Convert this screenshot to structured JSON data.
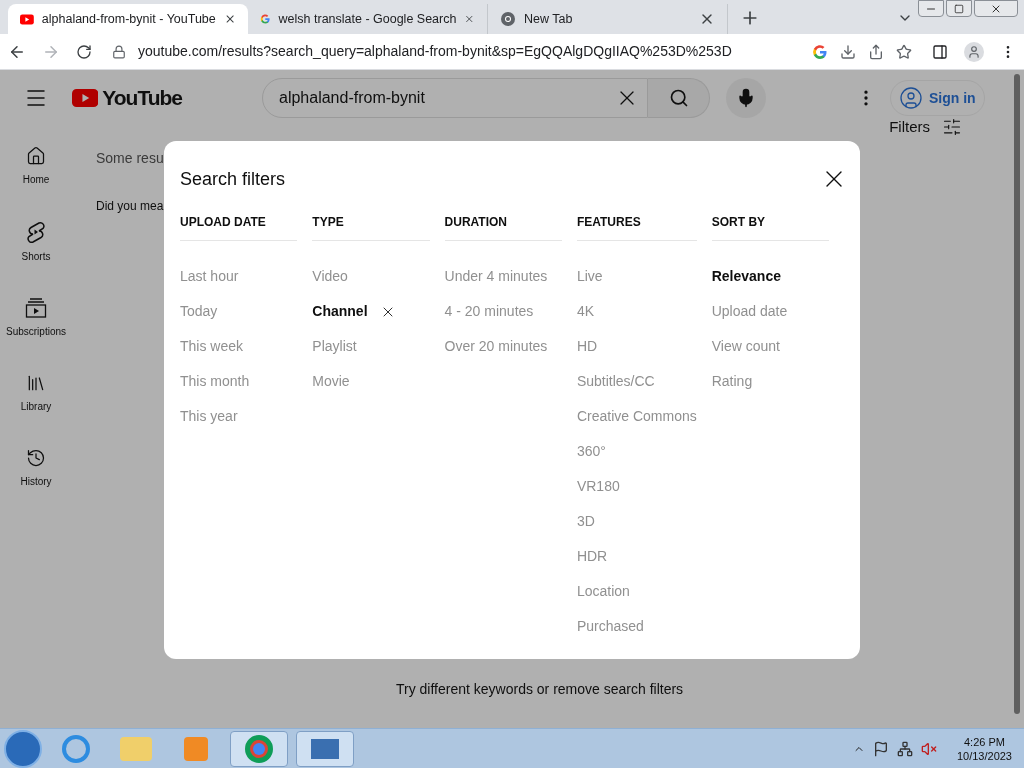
{
  "browser": {
    "tabs": [
      {
        "title": "alphaland-from-bynit - YouTube",
        "selected": true
      },
      {
        "title": "welsh translate - Google Search",
        "selected": false
      },
      {
        "title": "New Tab",
        "selected": false
      }
    ],
    "url": "youtube.com/results?search_query=alphaland-from-bynit&sp=EgQQAlgDQgIIAQ%253D%253D"
  },
  "header": {
    "logo": "YouTube",
    "search_value": "alphaland-from-bynit",
    "sign_in": "Sign in",
    "filters": "Filters"
  },
  "sidebar": {
    "items": [
      {
        "label": "Home"
      },
      {
        "label": "Shorts"
      },
      {
        "label": "Subscriptions"
      },
      {
        "label": "Library"
      },
      {
        "label": "History"
      }
    ]
  },
  "results": {
    "notice": "Some resu",
    "did_you_mean": "Did you mea",
    "empty_message": "Try different keywords or remove search filters"
  },
  "dialog": {
    "title": "Search filters",
    "columns": [
      {
        "heading": "UPLOAD DATE",
        "kind": "filter",
        "options": [
          {
            "label": "Last hour",
            "selected": false
          },
          {
            "label": "Today",
            "selected": false
          },
          {
            "label": "This week",
            "selected": false
          },
          {
            "label": "This month",
            "selected": false
          },
          {
            "label": "This year",
            "selected": false
          }
        ]
      },
      {
        "heading": "TYPE",
        "kind": "filter",
        "options": [
          {
            "label": "Video",
            "selected": false
          },
          {
            "label": "Channel",
            "selected": true
          },
          {
            "label": "Playlist",
            "selected": false
          },
          {
            "label": "Movie",
            "selected": false
          }
        ]
      },
      {
        "heading": "DURATION",
        "kind": "filter",
        "options": [
          {
            "label": "Under 4 minutes",
            "selected": false
          },
          {
            "label": "4 - 20 minutes",
            "selected": false
          },
          {
            "label": "Over 20 minutes",
            "selected": false
          }
        ]
      },
      {
        "heading": "FEATURES",
        "kind": "filter",
        "options": [
          {
            "label": "Live",
            "selected": false
          },
          {
            "label": "4K",
            "selected": false
          },
          {
            "label": "HD",
            "selected": false
          },
          {
            "label": "Subtitles/CC",
            "selected": false
          },
          {
            "label": "Creative Commons",
            "selected": false
          },
          {
            "label": "360°",
            "selected": false
          },
          {
            "label": "VR180",
            "selected": false
          },
          {
            "label": "3D",
            "selected": false
          },
          {
            "label": "HDR",
            "selected": false
          },
          {
            "label": "Location",
            "selected": false
          },
          {
            "label": "Purchased",
            "selected": false
          }
        ]
      },
      {
        "heading": "SORT BY",
        "kind": "sort",
        "options": [
          {
            "label": "Relevance",
            "selected": true
          },
          {
            "label": "Upload date",
            "selected": false
          },
          {
            "label": "View count",
            "selected": false
          },
          {
            "label": "Rating",
            "selected": false
          }
        ]
      }
    ]
  },
  "taskbar": {
    "time": "4:26 PM",
    "date": "10/13/2023"
  }
}
